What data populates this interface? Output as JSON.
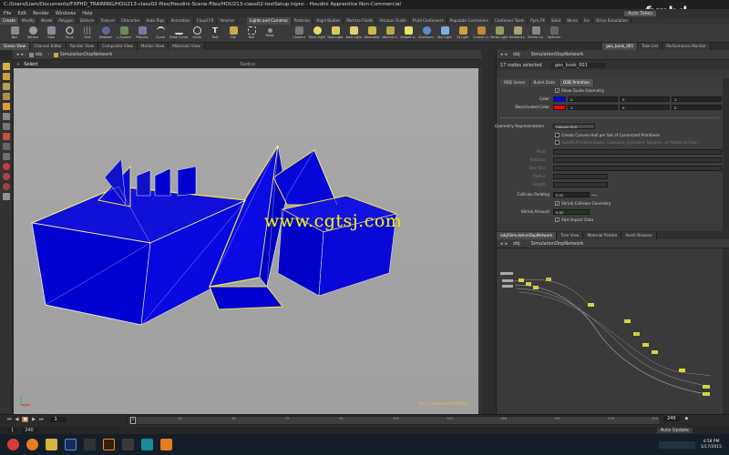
{
  "window": {
    "title": "C:/Users/Liam/Documents/FXPHD_TRAINING/HOU213-class02-files/Houdini-Scene-Files/HOU213-class02-testSetup.hipnc - Houdini Apprentice Non-Commercial",
    "watermark_brand": "fxphd",
    "auto_takes": "Auto Takes"
  },
  "menu": [
    "File",
    "Edit",
    "Render",
    "Windows",
    "Help"
  ],
  "shelf_tabs": [
    "Create",
    "Modify",
    "Model",
    "Polygon",
    "Deform",
    "Texture",
    "Character",
    "Auto Rigs",
    "Animation",
    "Cloud FX",
    "Volume",
    "Lights and Cameras",
    "Particles",
    "Rigid Bodies",
    "Particle Fluids",
    "Viscous Fluids",
    "Fluid Containers",
    "Populate Containers",
    "Container Tools",
    "Pyro FX",
    "Solid",
    "Wires",
    "Fur",
    "Drive Simulation"
  ],
  "shelf_tools_left": [
    "Box",
    "Sphere",
    "Tube",
    "Torus",
    "Grid",
    "Metaball",
    "L-System",
    "Platonic",
    "Curve",
    "Draw Curve",
    "Circle",
    "Text",
    "File",
    "Null",
    "Rivet"
  ],
  "shelf_tools_right": [
    "Camera",
    "Point Light",
    "Spot Light",
    "Area Light",
    "Geometry",
    "Volume Li.",
    "Distant Li.",
    "Environm.",
    "Sky Light",
    "GI Light",
    "Caustic Li.",
    "Portal Light",
    "Ambient L.",
    "Stereo Ca.",
    "Switcher"
  ],
  "pane_tabs": [
    "Scene View",
    "Channel Editor",
    "Render View",
    "Composite View",
    "Motion View",
    "Materials View"
  ],
  "viewport": {
    "path_root": "obj",
    "path_node": "SimulationDopNetwork",
    "tool": "Select",
    "radius_label": "Radius",
    "site_watermark": "www.cgtsj.com",
    "edition": "Non-Commercial Edition"
  },
  "right_panel": {
    "tabs": [
      "geo_book_001",
      "Take List",
      "Performance Monitor"
    ],
    "path_root": "obj",
    "path_node": "SimulationDopNetwork",
    "nodes_selected": "17 nodes selected",
    "node_name": "geo_book_001",
    "param_tabs": [
      "RBD Solver",
      "Bullet Data",
      "ODE Primitive"
    ],
    "show_guide": "Show Guide Geometry",
    "color_label": "Color",
    "color_values": [
      "0",
      "0",
      "1"
    ],
    "deactivated_label": "Deactivated Color",
    "deactivated_values": [
      "1",
      "0",
      "0"
    ],
    "geometry_rep_label": "Geometry Representation",
    "geometry_rep_value": "Convex Hull",
    "convex_hull_opt": "Create Convex Hull per Set of Connected Primitives",
    "autofit_opt": "Autofit Primitive Boxes, Capsules, Cylinders, Spheres, or Planes to Geo...",
    "dim_labels": [
      "Pivot",
      "Rotation",
      "Box Size",
      "Radius",
      "Length"
    ],
    "collision_padding_label": "Collision Padding",
    "collision_padding_value": "0.02",
    "shrink_geo": "Shrink Collision Geometry",
    "shrink_amount_label": "Shrink Amount",
    "shrink_amount_value": "0.02",
    "add_impact": "Add Impact Data",
    "colors": {
      "color": "#0000ff",
      "deactivated": "#ff0000"
    }
  },
  "network": {
    "tabs": [
      "/obj/SimulationDopNetwork",
      "Tree View",
      "Material Palette",
      "Asset Browser"
    ],
    "path_root": "obj",
    "path_node": "SimulationDopNetwork"
  },
  "timeline": {
    "current_frame": "1",
    "start_frame": "1",
    "end_frame": "240",
    "end_frame_display": "240",
    "ticks": [
      "24",
      "48",
      "72",
      "96",
      "120",
      "144",
      "168",
      "192",
      "216",
      "240"
    ],
    "auto_update": "Auto Update"
  },
  "taskbar": {
    "time": "4:58 PM",
    "date": "1/17/2015"
  }
}
